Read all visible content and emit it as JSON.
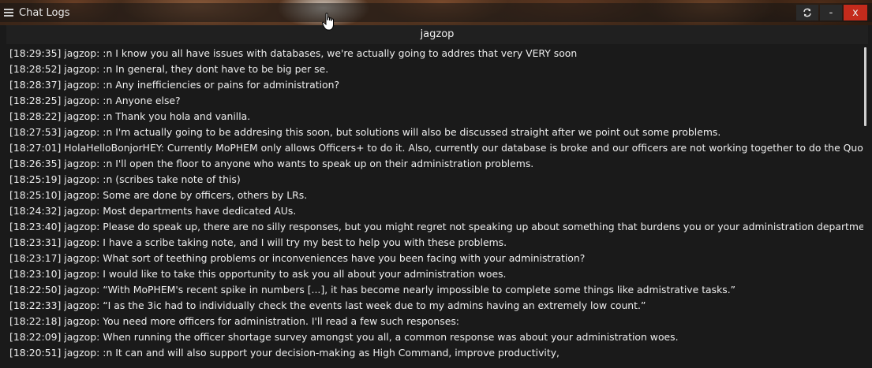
{
  "window": {
    "title": "Chat Logs",
    "channel": "jagzop",
    "controls": {
      "refresh_icon": "refresh-icon",
      "minimize_label": "-",
      "close_label": "x"
    }
  },
  "messages": [
    {
      "time": "[18:29:35]",
      "author": "jagzop",
      "text": ":n I know you all have issues with databases, we're actually going to addres that very VERY soon"
    },
    {
      "time": "[18:28:52]",
      "author": "jagzop",
      "text": ":n In general, they dont have to be big per se."
    },
    {
      "time": "[18:28:37]",
      "author": "jagzop",
      "text": ":n Any inefficiencies or pains for administration?"
    },
    {
      "time": "[18:28:25]",
      "author": "jagzop",
      "text": ":n Anyone else?"
    },
    {
      "time": "[18:28:22]",
      "author": "jagzop",
      "text": ":n Thank you hola and vanilla."
    },
    {
      "time": "[18:27:53]",
      "author": "jagzop",
      "text": ":n I'm actually going to be addresing this soon, but solutions will also be discussed straight after we point out some problems."
    },
    {
      "time": "[18:27:01]",
      "author": "HolaHelloBonjorHEY",
      "text": "Currently MoPHEM only allows Officers+ to do it. Also, currently our database is broke and our officers are not working together to do the Quota Submiss"
    },
    {
      "time": "[18:26:35]",
      "author": "jagzop",
      "text": ":n I'll open the floor to anyone who wants to speak up on their administration problems."
    },
    {
      "time": "[18:25:19]",
      "author": "jagzop",
      "text": ":n (scribes take note of this)"
    },
    {
      "time": "[18:25:10]",
      "author": "jagzop",
      "text": "Some are done by officers, others by LRs."
    },
    {
      "time": "[18:24:32]",
      "author": "jagzop",
      "text": "Most departments have dedicated AUs."
    },
    {
      "time": "[18:23:40]",
      "author": "jagzop",
      "text": "Please do speak up, there are no silly responses, but you might regret not speaking up about something that burdens you or your administration department."
    },
    {
      "time": "[18:23:31]",
      "author": "jagzop",
      "text": "I have a scribe taking note, and I will try my best to help you with these problems."
    },
    {
      "time": "[18:23:17]",
      "author": "jagzop",
      "text": "What sort of teething problems or inconveniences have you been facing with your administration?"
    },
    {
      "time": "[18:23:10]",
      "author": "jagzop",
      "text": "I would like to take this opportunity to ask you all about your administration woes."
    },
    {
      "time": "[18:22:50]",
      "author": "jagzop",
      "text": "“With MoPHEM's recent spike in numbers [...], it has become nearly impossible to complete some things like admistrative tasks.”"
    },
    {
      "time": "[18:22:33]",
      "author": "jagzop",
      "text": "“I as the 3ic had to individually check the events last week due to my admins having an extremely low count.”"
    },
    {
      "time": "[18:22:18]",
      "author": "jagzop",
      "text": "You need more officers for administration. I'll read a few such responses:"
    },
    {
      "time": "[18:22:09]",
      "author": "jagzop",
      "text": "When running the officer shortage survey amongst you all, a common response was about your administration woes."
    },
    {
      "time": "[18:20:51]",
      "author": "jagzop",
      "text": ":n It can and will also support your decision-making as High Command, improve productivity,"
    }
  ],
  "colors": {
    "close": "#c42b1c",
    "text": "#ededed",
    "panel": "#1a1a1a"
  }
}
